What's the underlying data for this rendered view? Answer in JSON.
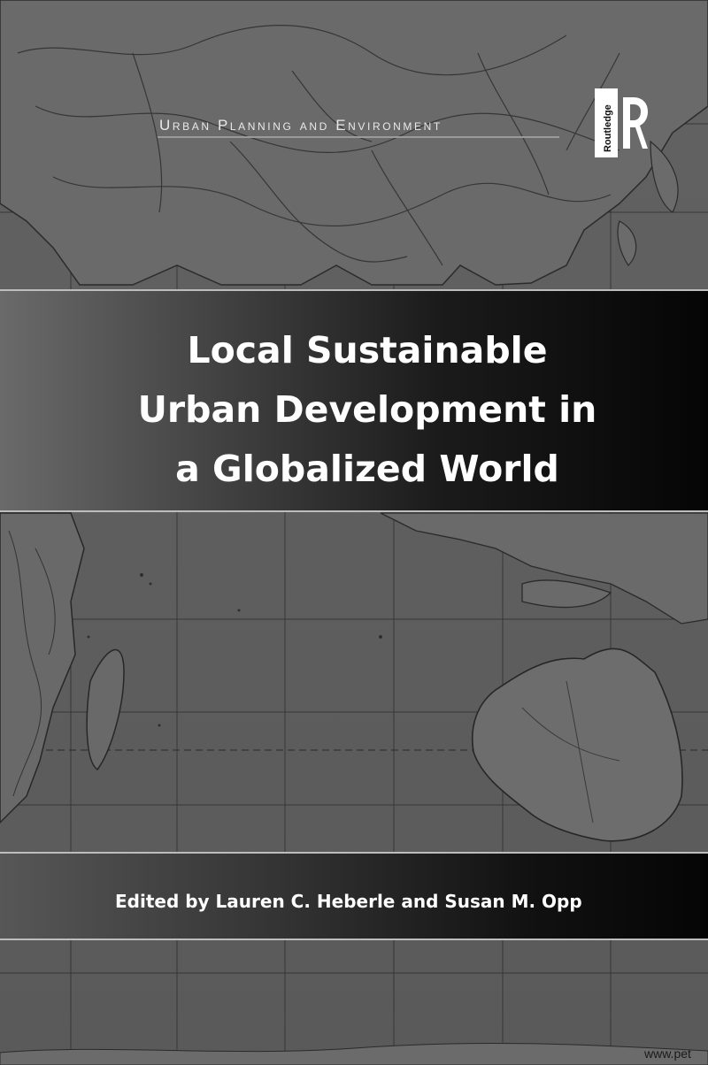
{
  "series": {
    "label": "Urban Planning and Environment"
  },
  "publisher": {
    "name": "Routledge",
    "logo_icon": "routledge-r-logo-icon"
  },
  "book": {
    "title_lines": [
      "Local Sustainable",
      "Urban Development in",
      "a Globalized World"
    ],
    "editors": "Edited by Lauren C. Heberle and Susan M. Opp"
  },
  "watermark": "www.pet",
  "colors": {
    "background": "#5f5f5f",
    "band_dark": "#050505",
    "text": "#ffffff",
    "rule": "#bdbdbd"
  }
}
